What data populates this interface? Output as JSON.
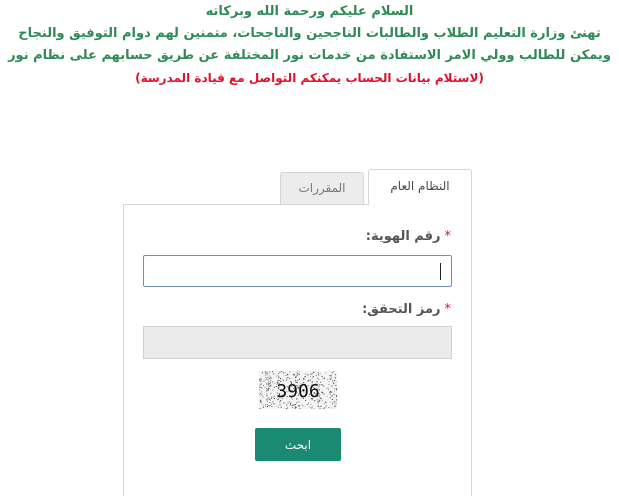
{
  "notice": {
    "line1": "السلام عليكم ورحمة الله وبركاته",
    "line2": "تهنئ وزارة التعليم الطلاب والطالبات الناجحين والناجحات، متمنين لهم دوام التوفيق والنجاح",
    "line3": "ويمكن للطالب وولي الامر الاستفادة من خدمات نور المختلفة عن طريق حسابهم على نظام نور",
    "line4": "(لاستلام بيانات الحساب يمكنكم التواصل مع قيادة المدرسة)"
  },
  "tabs": {
    "general": "النظام العام",
    "courses": "المقررات"
  },
  "form": {
    "required_mark": "*",
    "id_label": "رقم الهوية:",
    "id_value": "",
    "captcha_label": "رمز التحقق:",
    "captcha_value": "",
    "captcha_text": "3906",
    "search_button": "ابحث"
  },
  "colors": {
    "notice_green": "#2e8b57",
    "notice_red": "#e0102a",
    "button": "#1b8a73"
  }
}
